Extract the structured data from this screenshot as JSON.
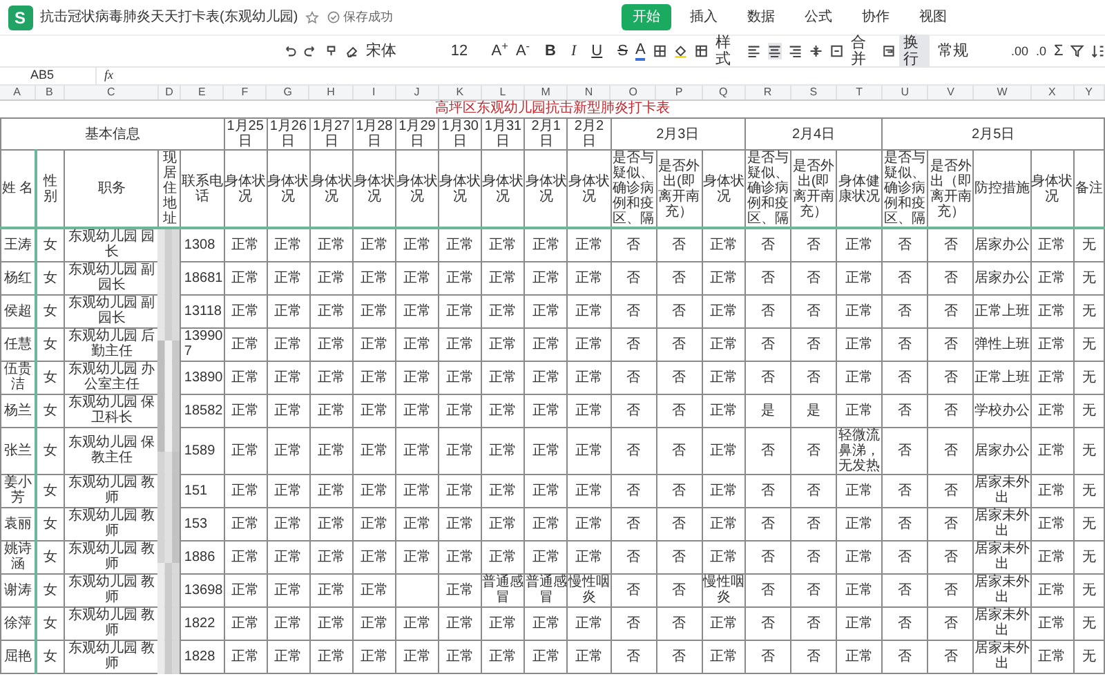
{
  "app": {
    "logo": "S",
    "title": "抗击冠状病毒肺炎天天打卡表(东观幼儿园)",
    "save_status": "保存成功",
    "menu_tabs": [
      {
        "label": "开始",
        "selected": true
      },
      {
        "label": "插入",
        "selected": false
      },
      {
        "label": "数据",
        "selected": false
      },
      {
        "label": "公式",
        "selected": false
      },
      {
        "label": "协作",
        "selected": false
      },
      {
        "label": "视图",
        "selected": false
      }
    ]
  },
  "toolbar": {
    "font": "宋体",
    "font_size": "12",
    "grow_font": "A$^{+}$",
    "shrink_font": "A$^{-}$",
    "format_buttons": [
      "B",
      "I",
      "U",
      "S"
    ],
    "font_color": "A",
    "style_label": "样式",
    "merge_label": "合并",
    "wrap": {
      "label": "换行",
      "on": true
    },
    "number_format": "常规",
    "decimal_add": ".00",
    "decimal_remove": ".0",
    "sum": "Σ"
  },
  "formula_bar": {
    "cell_ref": "AB5",
    "fx": "fx"
  },
  "column_letters": [
    "A",
    "B",
    "C",
    "D",
    "E",
    "F",
    "G",
    "H",
    "I",
    "J",
    "K",
    "L",
    "M",
    "N",
    "O",
    "P",
    "Q",
    "R",
    "S",
    "T",
    "U",
    "V",
    "W",
    "X",
    "Y"
  ],
  "sheet": {
    "title": "高坪区东观幼儿园抗击新型肺炎打卡表",
    "basic_info": {
      "title": "基本信息",
      "columns": [
        "姓 名",
        "性别",
        "职务",
        "现居住地址",
        "联系电话"
      ]
    },
    "date_groups": [
      {
        "date": "1月25日",
        "columns": [
          "身体状况"
        ]
      },
      {
        "date": "1月26日",
        "columns": [
          "身体状况"
        ]
      },
      {
        "date": "1月27日",
        "columns": [
          "身体状况"
        ]
      },
      {
        "date": "1月28日",
        "columns": [
          "身体状况"
        ]
      },
      {
        "date": "1月29日",
        "columns": [
          "身体状况"
        ]
      },
      {
        "date": "1月30日",
        "columns": [
          "身体状况"
        ]
      },
      {
        "date": "1月31日",
        "columns": [
          "身体状况"
        ]
      },
      {
        "date": "2月1日",
        "columns": [
          "身体状况"
        ]
      },
      {
        "date": "2月2日",
        "columns": [
          "身体状况"
        ]
      },
      {
        "date": "2月3日",
        "columns": [
          "是否与疑似、确诊病例和疫区、隔",
          "是否外出(即离开南充）",
          "身体状况"
        ]
      },
      {
        "date": "2月4日",
        "columns": [
          "是否与疑似、确诊病例和疫区、隔",
          "是否外出(即离开南充）",
          "身体健康状况"
        ]
      },
      {
        "date": "2月5日",
        "columns": [
          "是否与疑似、确诊病例和疫区、隔",
          "是否外出（即离开南充）",
          "防控措施",
          "身体状况",
          "备注"
        ]
      }
    ],
    "rows": [
      {
        "name": "王涛",
        "gender": "女",
        "role": "东观幼儿园 园长",
        "phone": "1308",
        "daily": [
          "正常",
          "正常",
          "正常",
          "正常",
          "正常",
          "正常",
          "正常",
          "正常",
          "正常",
          "否",
          "否",
          "正常",
          "否",
          "否",
          "正常",
          "否",
          "否",
          "居家办公",
          "正常",
          "无"
        ]
      },
      {
        "name": "杨红",
        "gender": "女",
        "role": "东观幼儿园 副园长",
        "phone": "18681",
        "daily": [
          "正常",
          "正常",
          "正常",
          "正常",
          "正常",
          "正常",
          "正常",
          "正常",
          "正常",
          "否",
          "否",
          "正常",
          "否",
          "否",
          "正常",
          "否",
          "否",
          "居家办公",
          "正常",
          "无"
        ]
      },
      {
        "name": "侯超",
        "gender": "女",
        "role": "东观幼儿园 副园长",
        "phone": "13118",
        "daily": [
          "正常",
          "正常",
          "正常",
          "正常",
          "正常",
          "正常",
          "正常",
          "正常",
          "正常",
          "否",
          "否",
          "正常",
          "否",
          "否",
          "正常",
          "否",
          "否",
          "正常上班",
          "正常",
          "无"
        ]
      },
      {
        "name": "任慧",
        "gender": "女",
        "role": "东观幼儿园 后勤主任",
        "phone": "139907",
        "daily": [
          "正常",
          "正常",
          "正常",
          "正常",
          "正常",
          "正常",
          "正常",
          "正常",
          "正常",
          "否",
          "否",
          "正常",
          "否",
          "否",
          "正常",
          "否",
          "否",
          "弹性上班",
          "正常",
          "无"
        ]
      },
      {
        "name": "伍贵洁",
        "gender": "女",
        "role": "东观幼儿园 办公室主任",
        "phone": "13890",
        "daily": [
          "正常",
          "正常",
          "正常",
          "正常",
          "正常",
          "正常",
          "正常",
          "正常",
          "正常",
          "否",
          "否",
          "正常",
          "否",
          "否",
          "正常",
          "否",
          "否",
          "正常上班",
          "正常",
          "无"
        ]
      },
      {
        "name": "杨兰",
        "gender": "女",
        "role": "东观幼儿园 保卫科长",
        "phone": "18582",
        "daily": [
          "正常",
          "正常",
          "正常",
          "正常",
          "正常",
          "正常",
          "正常",
          "正常",
          "正常",
          "否",
          "否",
          "正常",
          "是",
          "是",
          "正常",
          "否",
          "否",
          "学校办公",
          "正常",
          "无"
        ]
      },
      {
        "name": "张兰",
        "gender": "女",
        "role": "东观幼儿园 保教主任",
        "phone": "1589",
        "daily": [
          "正常",
          "正常",
          "正常",
          "正常",
          "正常",
          "正常",
          "正常",
          "正常",
          "正常",
          "否",
          "否",
          "正常",
          "否",
          "否",
          "轻微流鼻涕，无发热",
          "否",
          "否",
          "居家办公",
          "正常",
          "无"
        ]
      },
      {
        "name": "姜小芳",
        "gender": "女",
        "role": "东观幼儿园 教师",
        "phone": "151",
        "daily": [
          "正常",
          "正常",
          "正常",
          "正常",
          "正常",
          "正常",
          "正常",
          "正常",
          "正常",
          "否",
          "否",
          "正常",
          "否",
          "否",
          "正常",
          "否",
          "否",
          "居家未外出",
          "正常",
          "无"
        ]
      },
      {
        "name": "袁丽",
        "gender": "女",
        "role": "东观幼儿园 教师",
        "phone": "153",
        "daily": [
          "正常",
          "正常",
          "正常",
          "正常",
          "正常",
          "正常",
          "正常",
          "正常",
          "正常",
          "否",
          "否",
          "正常",
          "否",
          "否",
          "正常",
          "否",
          "否",
          "居家未外出",
          "正常",
          "无"
        ]
      },
      {
        "name": "姚诗涵",
        "gender": "女",
        "role": "东观幼儿园 教师",
        "phone": "1886",
        "daily": [
          "正常",
          "正常",
          "正常",
          "正常",
          "正常",
          "正常",
          "正常",
          "正常",
          "正常",
          "否",
          "否",
          "正常",
          "否",
          "否",
          "正常",
          "否",
          "否",
          "居家未外出",
          "正常",
          "无"
        ]
      },
      {
        "name": "谢涛",
        "gender": "女",
        "role": "东观幼儿园 教师",
        "phone": "13698",
        "daily": [
          "正常",
          "正常",
          "正常",
          "正常"
        ],
        "daily_after_blank": [
          "正常",
          "普通感冒",
          "普通感冒",
          "慢性咽炎",
          "否",
          "否",
          "慢性咽炎",
          "否",
          "否",
          "正常",
          "否",
          "否",
          "居家未外出",
          "正常",
          "无"
        ]
      },
      {
        "name": "徐萍",
        "gender": "女",
        "role": "东观幼儿园 教师",
        "phone": "1822",
        "daily": [
          "正常",
          "正常",
          "正常",
          "正常",
          "正常",
          "正常",
          "正常",
          "正常",
          "正常",
          "否",
          "否",
          "正常",
          "否",
          "否",
          "正常",
          "否",
          "否",
          "居家未外出",
          "正常",
          "无"
        ]
      },
      {
        "name": "屈艳",
        "gender": "女",
        "role": "东观幼儿园 教师",
        "phone": "1828",
        "daily": [
          "正常",
          "正常",
          "正常",
          "正常",
          "正常",
          "正常",
          "正常",
          "正常",
          "正常",
          "否",
          "否",
          "正常",
          "否",
          "否",
          "正常",
          "否",
          "否",
          "居家未外出",
          "正常",
          "无"
        ]
      }
    ]
  }
}
